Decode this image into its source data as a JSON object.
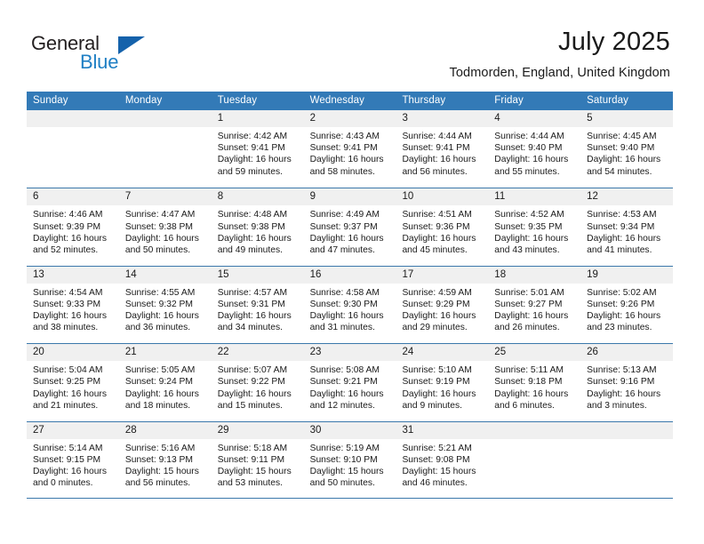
{
  "brand": {
    "name_part1": "General",
    "name_part2": "Blue"
  },
  "header": {
    "title": "July 2025",
    "location": "Todmorden, England, United Kingdom"
  },
  "colors": {
    "header_blue": "#337ab7",
    "brand_blue": "#1f7fc4",
    "triangle_blue": "#1562ab",
    "day_band_gray": "#f0f0f0",
    "row_border": "#3b78ab"
  },
  "weekdays": [
    "Sunday",
    "Monday",
    "Tuesday",
    "Wednesday",
    "Thursday",
    "Friday",
    "Saturday"
  ],
  "weeks": [
    [
      {
        "day": "",
        "sunrise": "",
        "sunset": "",
        "daylight_line1": "",
        "daylight_line2": "",
        "empty": true
      },
      {
        "day": "",
        "sunrise": "",
        "sunset": "",
        "daylight_line1": "",
        "daylight_line2": "",
        "empty": true
      },
      {
        "day": "1",
        "sunrise": "Sunrise: 4:42 AM",
        "sunset": "Sunset: 9:41 PM",
        "daylight_line1": "Daylight: 16 hours",
        "daylight_line2": "and 59 minutes."
      },
      {
        "day": "2",
        "sunrise": "Sunrise: 4:43 AM",
        "sunset": "Sunset: 9:41 PM",
        "daylight_line1": "Daylight: 16 hours",
        "daylight_line2": "and 58 minutes."
      },
      {
        "day": "3",
        "sunrise": "Sunrise: 4:44 AM",
        "sunset": "Sunset: 9:41 PM",
        "daylight_line1": "Daylight: 16 hours",
        "daylight_line2": "and 56 minutes."
      },
      {
        "day": "4",
        "sunrise": "Sunrise: 4:44 AM",
        "sunset": "Sunset: 9:40 PM",
        "daylight_line1": "Daylight: 16 hours",
        "daylight_line2": "and 55 minutes."
      },
      {
        "day": "5",
        "sunrise": "Sunrise: 4:45 AM",
        "sunset": "Sunset: 9:40 PM",
        "daylight_line1": "Daylight: 16 hours",
        "daylight_line2": "and 54 minutes."
      }
    ],
    [
      {
        "day": "6",
        "sunrise": "Sunrise: 4:46 AM",
        "sunset": "Sunset: 9:39 PM",
        "daylight_line1": "Daylight: 16 hours",
        "daylight_line2": "and 52 minutes."
      },
      {
        "day": "7",
        "sunrise": "Sunrise: 4:47 AM",
        "sunset": "Sunset: 9:38 PM",
        "daylight_line1": "Daylight: 16 hours",
        "daylight_line2": "and 50 minutes."
      },
      {
        "day": "8",
        "sunrise": "Sunrise: 4:48 AM",
        "sunset": "Sunset: 9:38 PM",
        "daylight_line1": "Daylight: 16 hours",
        "daylight_line2": "and 49 minutes."
      },
      {
        "day": "9",
        "sunrise": "Sunrise: 4:49 AM",
        "sunset": "Sunset: 9:37 PM",
        "daylight_line1": "Daylight: 16 hours",
        "daylight_line2": "and 47 minutes."
      },
      {
        "day": "10",
        "sunrise": "Sunrise: 4:51 AM",
        "sunset": "Sunset: 9:36 PM",
        "daylight_line1": "Daylight: 16 hours",
        "daylight_line2": "and 45 minutes."
      },
      {
        "day": "11",
        "sunrise": "Sunrise: 4:52 AM",
        "sunset": "Sunset: 9:35 PM",
        "daylight_line1": "Daylight: 16 hours",
        "daylight_line2": "and 43 minutes."
      },
      {
        "day": "12",
        "sunrise": "Sunrise: 4:53 AM",
        "sunset": "Sunset: 9:34 PM",
        "daylight_line1": "Daylight: 16 hours",
        "daylight_line2": "and 41 minutes."
      }
    ],
    [
      {
        "day": "13",
        "sunrise": "Sunrise: 4:54 AM",
        "sunset": "Sunset: 9:33 PM",
        "daylight_line1": "Daylight: 16 hours",
        "daylight_line2": "and 38 minutes."
      },
      {
        "day": "14",
        "sunrise": "Sunrise: 4:55 AM",
        "sunset": "Sunset: 9:32 PM",
        "daylight_line1": "Daylight: 16 hours",
        "daylight_line2": "and 36 minutes."
      },
      {
        "day": "15",
        "sunrise": "Sunrise: 4:57 AM",
        "sunset": "Sunset: 9:31 PM",
        "daylight_line1": "Daylight: 16 hours",
        "daylight_line2": "and 34 minutes."
      },
      {
        "day": "16",
        "sunrise": "Sunrise: 4:58 AM",
        "sunset": "Sunset: 9:30 PM",
        "daylight_line1": "Daylight: 16 hours",
        "daylight_line2": "and 31 minutes."
      },
      {
        "day": "17",
        "sunrise": "Sunrise: 4:59 AM",
        "sunset": "Sunset: 9:29 PM",
        "daylight_line1": "Daylight: 16 hours",
        "daylight_line2": "and 29 minutes."
      },
      {
        "day": "18",
        "sunrise": "Sunrise: 5:01 AM",
        "sunset": "Sunset: 9:27 PM",
        "daylight_line1": "Daylight: 16 hours",
        "daylight_line2": "and 26 minutes."
      },
      {
        "day": "19",
        "sunrise": "Sunrise: 5:02 AM",
        "sunset": "Sunset: 9:26 PM",
        "daylight_line1": "Daylight: 16 hours",
        "daylight_line2": "and 23 minutes."
      }
    ],
    [
      {
        "day": "20",
        "sunrise": "Sunrise: 5:04 AM",
        "sunset": "Sunset: 9:25 PM",
        "daylight_line1": "Daylight: 16 hours",
        "daylight_line2": "and 21 minutes."
      },
      {
        "day": "21",
        "sunrise": "Sunrise: 5:05 AM",
        "sunset": "Sunset: 9:24 PM",
        "daylight_line1": "Daylight: 16 hours",
        "daylight_line2": "and 18 minutes."
      },
      {
        "day": "22",
        "sunrise": "Sunrise: 5:07 AM",
        "sunset": "Sunset: 9:22 PM",
        "daylight_line1": "Daylight: 16 hours",
        "daylight_line2": "and 15 minutes."
      },
      {
        "day": "23",
        "sunrise": "Sunrise: 5:08 AM",
        "sunset": "Sunset: 9:21 PM",
        "daylight_line1": "Daylight: 16 hours",
        "daylight_line2": "and 12 minutes."
      },
      {
        "day": "24",
        "sunrise": "Sunrise: 5:10 AM",
        "sunset": "Sunset: 9:19 PM",
        "daylight_line1": "Daylight: 16 hours",
        "daylight_line2": "and 9 minutes."
      },
      {
        "day": "25",
        "sunrise": "Sunrise: 5:11 AM",
        "sunset": "Sunset: 9:18 PM",
        "daylight_line1": "Daylight: 16 hours",
        "daylight_line2": "and 6 minutes."
      },
      {
        "day": "26",
        "sunrise": "Sunrise: 5:13 AM",
        "sunset": "Sunset: 9:16 PM",
        "daylight_line1": "Daylight: 16 hours",
        "daylight_line2": "and 3 minutes."
      }
    ],
    [
      {
        "day": "27",
        "sunrise": "Sunrise: 5:14 AM",
        "sunset": "Sunset: 9:15 PM",
        "daylight_line1": "Daylight: 16 hours",
        "daylight_line2": "and 0 minutes."
      },
      {
        "day": "28",
        "sunrise": "Sunrise: 5:16 AM",
        "sunset": "Sunset: 9:13 PM",
        "daylight_line1": "Daylight: 15 hours",
        "daylight_line2": "and 56 minutes."
      },
      {
        "day": "29",
        "sunrise": "Sunrise: 5:18 AM",
        "sunset": "Sunset: 9:11 PM",
        "daylight_line1": "Daylight: 15 hours",
        "daylight_line2": "and 53 minutes."
      },
      {
        "day": "30",
        "sunrise": "Sunrise: 5:19 AM",
        "sunset": "Sunset: 9:10 PM",
        "daylight_line1": "Daylight: 15 hours",
        "daylight_line2": "and 50 minutes."
      },
      {
        "day": "31",
        "sunrise": "Sunrise: 5:21 AM",
        "sunset": "Sunset: 9:08 PM",
        "daylight_line1": "Daylight: 15 hours",
        "daylight_line2": "and 46 minutes."
      },
      {
        "day": "",
        "sunrise": "",
        "sunset": "",
        "daylight_line1": "",
        "daylight_line2": "",
        "empty": true
      },
      {
        "day": "",
        "sunrise": "",
        "sunset": "",
        "daylight_line1": "",
        "daylight_line2": "",
        "empty": true
      }
    ]
  ]
}
